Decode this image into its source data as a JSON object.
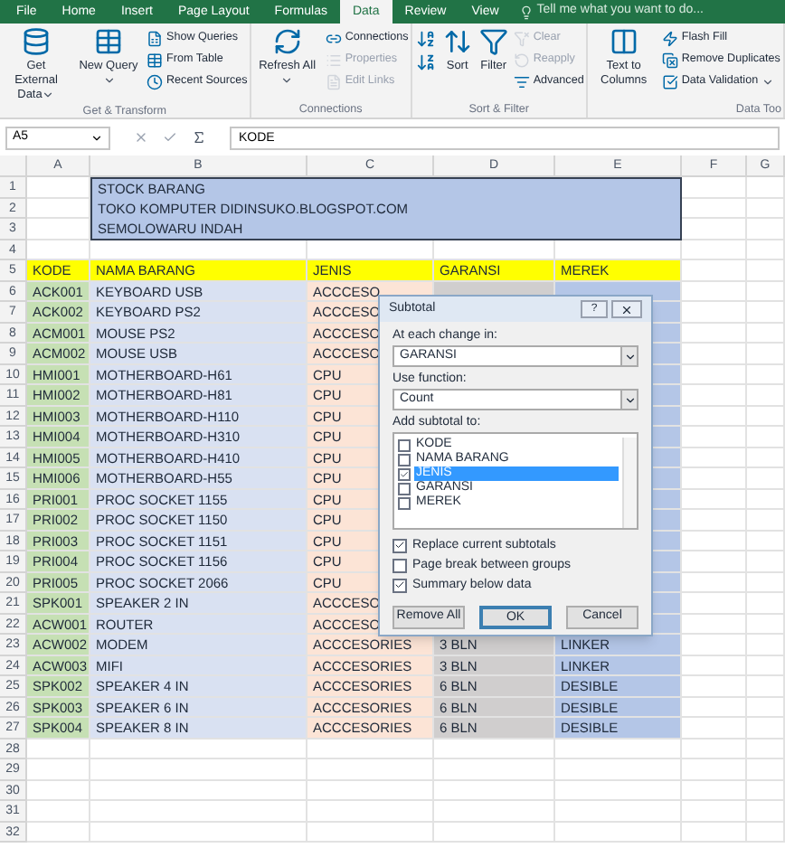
{
  "tabs": [
    {
      "label": "File",
      "selected": false
    },
    {
      "label": "Home",
      "selected": false
    },
    {
      "label": "Insert",
      "selected": false
    },
    {
      "label": "Page Layout",
      "selected": false
    },
    {
      "label": "Formulas",
      "selected": false
    },
    {
      "label": "Data",
      "selected": true
    },
    {
      "label": "Review",
      "selected": false
    },
    {
      "label": "View",
      "selected": false
    }
  ],
  "tell_me": {
    "placeholder": "Tell me what you want to do..."
  },
  "ribbon_groups": [
    {
      "label": "Get & Transform",
      "columns": [
        [
          {
            "kind": "large",
            "label": "Get External Data",
            "menu": true,
            "disabled": false
          }
        ],
        [
          {
            "kind": "large",
            "label": "New Query",
            "menu": true,
            "disabled": false
          }
        ],
        [
          {
            "kind": "small",
            "label": "Show Queries",
            "disabled": false
          },
          {
            "kind": "small",
            "label": "From Table",
            "disabled": false
          },
          {
            "kind": "small",
            "label": "Recent Sources",
            "disabled": false
          }
        ]
      ]
    },
    {
      "label": "Connections",
      "columns": [
        [
          {
            "kind": "large",
            "label": "Refresh All",
            "menu": true,
            "disabled": false
          }
        ],
        [
          {
            "kind": "small",
            "label": "Connections",
            "disabled": false
          },
          {
            "kind": "small",
            "label": "Properties",
            "disabled": true
          },
          {
            "kind": "small",
            "label": "Edit Links",
            "disabled": true
          }
        ]
      ]
    },
    {
      "label": "Sort & Filter",
      "columns": [
        [
          {
            "kind": "icon",
            "disabled": false
          },
          {
            "kind": "icon",
            "disabled": false
          }
        ],
        [
          {
            "kind": "large",
            "label": "Sort",
            "menu": false,
            "disabled": false
          }
        ],
        [
          {
            "kind": "large",
            "label": "Filter",
            "menu": false,
            "disabled": false
          }
        ],
        [
          {
            "kind": "small",
            "label": "Clear",
            "disabled": true
          },
          {
            "kind": "small",
            "label": "Reapply",
            "disabled": true
          },
          {
            "kind": "small",
            "label": "Advanced",
            "disabled": false
          }
        ]
      ]
    },
    {
      "label": "Data Too",
      "columns": [
        [
          {
            "kind": "large",
            "label": "Text to Columns",
            "menu": false,
            "disabled": false
          }
        ],
        [
          {
            "kind": "small",
            "label": "Flash Fill",
            "disabled": false
          },
          {
            "kind": "small",
            "label": "Remove Duplicates",
            "disabled": false
          },
          {
            "kind": "small",
            "label": "Data Validation",
            "menu": true,
            "disabled": false
          }
        ]
      ]
    }
  ],
  "formula_bar": {
    "name_box": "A5",
    "value": "KODE"
  },
  "columns": [
    "A",
    "B",
    "C",
    "D",
    "E",
    "F",
    "G"
  ],
  "row_numbers": [
    "1",
    "2",
    "3",
    "4",
    "5",
    "6",
    "7",
    "8",
    "9",
    "10",
    "11",
    "12",
    "13",
    "14",
    "15",
    "16",
    "17",
    "18",
    "19",
    "20",
    "21",
    "22",
    "23",
    "24",
    "25",
    "26",
    "27",
    "28",
    "29",
    "30",
    "31",
    "32"
  ],
  "title_lines": [
    "STOCK BARANG",
    "TOKO KOMPUTER DIDINSUKO.BLOGSPOT.COM",
    "SEMOLOWARU INDAH"
  ],
  "header": [
    "KODE",
    "NAMA BARANG",
    "JENIS",
    "GARANSI",
    "MEREK"
  ],
  "data_rows": [
    [
      "ACK001",
      "KEYBOARD USB",
      "ACCCESO"
    ],
    [
      "ACK002",
      "KEYBOARD PS2",
      "ACCCESO"
    ],
    [
      "ACM001",
      "MOUSE PS2",
      "ACCCESO"
    ],
    [
      "ACM002",
      "MOUSE USB",
      "ACCCESO"
    ],
    [
      "HMI001",
      "MOTHERBOARD-H61",
      "CPU"
    ],
    [
      "HMI002",
      "MOTHERBOARD-H81",
      "CPU"
    ],
    [
      "HMI003",
      "MOTHERBOARD-H110",
      "CPU"
    ],
    [
      "HMI004",
      "MOTHERBOARD-H310",
      "CPU"
    ],
    [
      "HMI005",
      "MOTHERBOARD-H410",
      "CPU"
    ],
    [
      "HMI006",
      "MOTHERBOARD-H55",
      "CPU"
    ],
    [
      "PRI001",
      "PROC SOCKET 1155",
      "CPU"
    ],
    [
      "PRI002",
      "PROC SOCKET 1150",
      "CPU"
    ],
    [
      "PRI003",
      "PROC SOCKET 1151",
      "CPU"
    ],
    [
      "PRI004",
      "PROC SOCKET 1156",
      "CPU"
    ],
    [
      "PRI005",
      "PROC SOCKET 2066",
      "CPU"
    ],
    [
      "SPK001",
      "SPEAKER 2 IN",
      "ACCCESO"
    ],
    [
      "ACW001",
      "ROUTER",
      "ACCCESO"
    ],
    [
      "ACW002",
      "MODEM",
      "ACCCESORIES",
      "3 BLN",
      "LINKER"
    ],
    [
      "ACW003",
      "MIFI",
      "ACCCESORIES",
      "3 BLN",
      "LINKER"
    ],
    [
      "SPK002",
      "SPEAKER 4 IN",
      "ACCCESORIES",
      "6 BLN",
      "DESIBLE"
    ],
    [
      "SPK003",
      "SPEAKER 6 IN",
      "ACCCESORIES",
      "6 BLN",
      "DESIBLE"
    ],
    [
      "SPK004",
      "SPEAKER 8 IN",
      "ACCCESORIES",
      "6 BLN",
      "DESIBLE"
    ]
  ],
  "dialog": {
    "title": "Subtotal",
    "help": "?",
    "change_label": "At each change in:",
    "change_value": "GARANSI",
    "function_label": "Use function:",
    "function_value": "Count",
    "add_label": "Add subtotal to:",
    "add_items": [
      {
        "label": "KODE",
        "checked": false,
        "selected": false
      },
      {
        "label": "NAMA BARANG",
        "checked": false,
        "selected": false
      },
      {
        "label": "JENIS",
        "checked": true,
        "selected": true
      },
      {
        "label": "GARANSI",
        "checked": false,
        "selected": false
      },
      {
        "label": "MEREK",
        "checked": false,
        "selected": false
      }
    ],
    "options": [
      {
        "label": "Replace current subtotals",
        "checked": true
      },
      {
        "label": "Page break between groups",
        "checked": false
      },
      {
        "label": "Summary below data",
        "checked": true
      }
    ],
    "buttons": [
      {
        "label": "Remove All",
        "default": false
      },
      {
        "label": "OK",
        "default": true
      },
      {
        "label": "Cancel",
        "default": false
      }
    ]
  }
}
